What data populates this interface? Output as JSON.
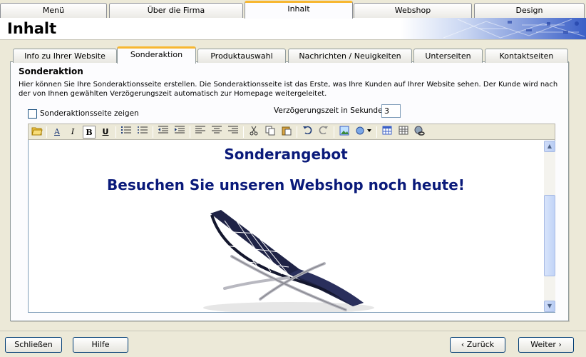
{
  "top_tabs": [
    "Menü",
    "Über die Firma",
    "Inhalt",
    "Webshop",
    "Design"
  ],
  "header": {
    "title": "Inhalt"
  },
  "inner_tabs": [
    "Info zu Ihrer Website",
    "Sonderaktion",
    "Produktauswahl",
    "Nachrichten / Neuigkeiten",
    "Unterseiten",
    "Kontaktseiten"
  ],
  "section": {
    "title": "Sonderaktion",
    "description": "Hier können Sie Ihre Sonderaktionsseite erstellen. Die Sonderaktionsseite ist das Erste, was Ihre Kunden auf Ihrer Website sehen. Der Kunde wird nach der von Ihnen gewählten Verzögerungszeit automatisch zur Homepage weitergeleitet."
  },
  "options": {
    "show_label": "Sonderaktionsseite zeigen",
    "show_checked": false,
    "delay_label": "Verzögerungszeit in Sekunden",
    "delay_value": "3"
  },
  "toolbar": {
    "bold": "B",
    "italic": "I",
    "underline": "U",
    "font": "A"
  },
  "editor": {
    "heading": "Sonderangebot",
    "subheading": "Besuchen Sie unseren Webshop noch heute!"
  },
  "buttons": {
    "close": "Schließen",
    "help": "Hilfe",
    "back": "‹ Zurück",
    "next": "Weiter ›"
  },
  "colors": {
    "tab_accent": "#f7b731",
    "promo_text": "#0a1a7a"
  }
}
